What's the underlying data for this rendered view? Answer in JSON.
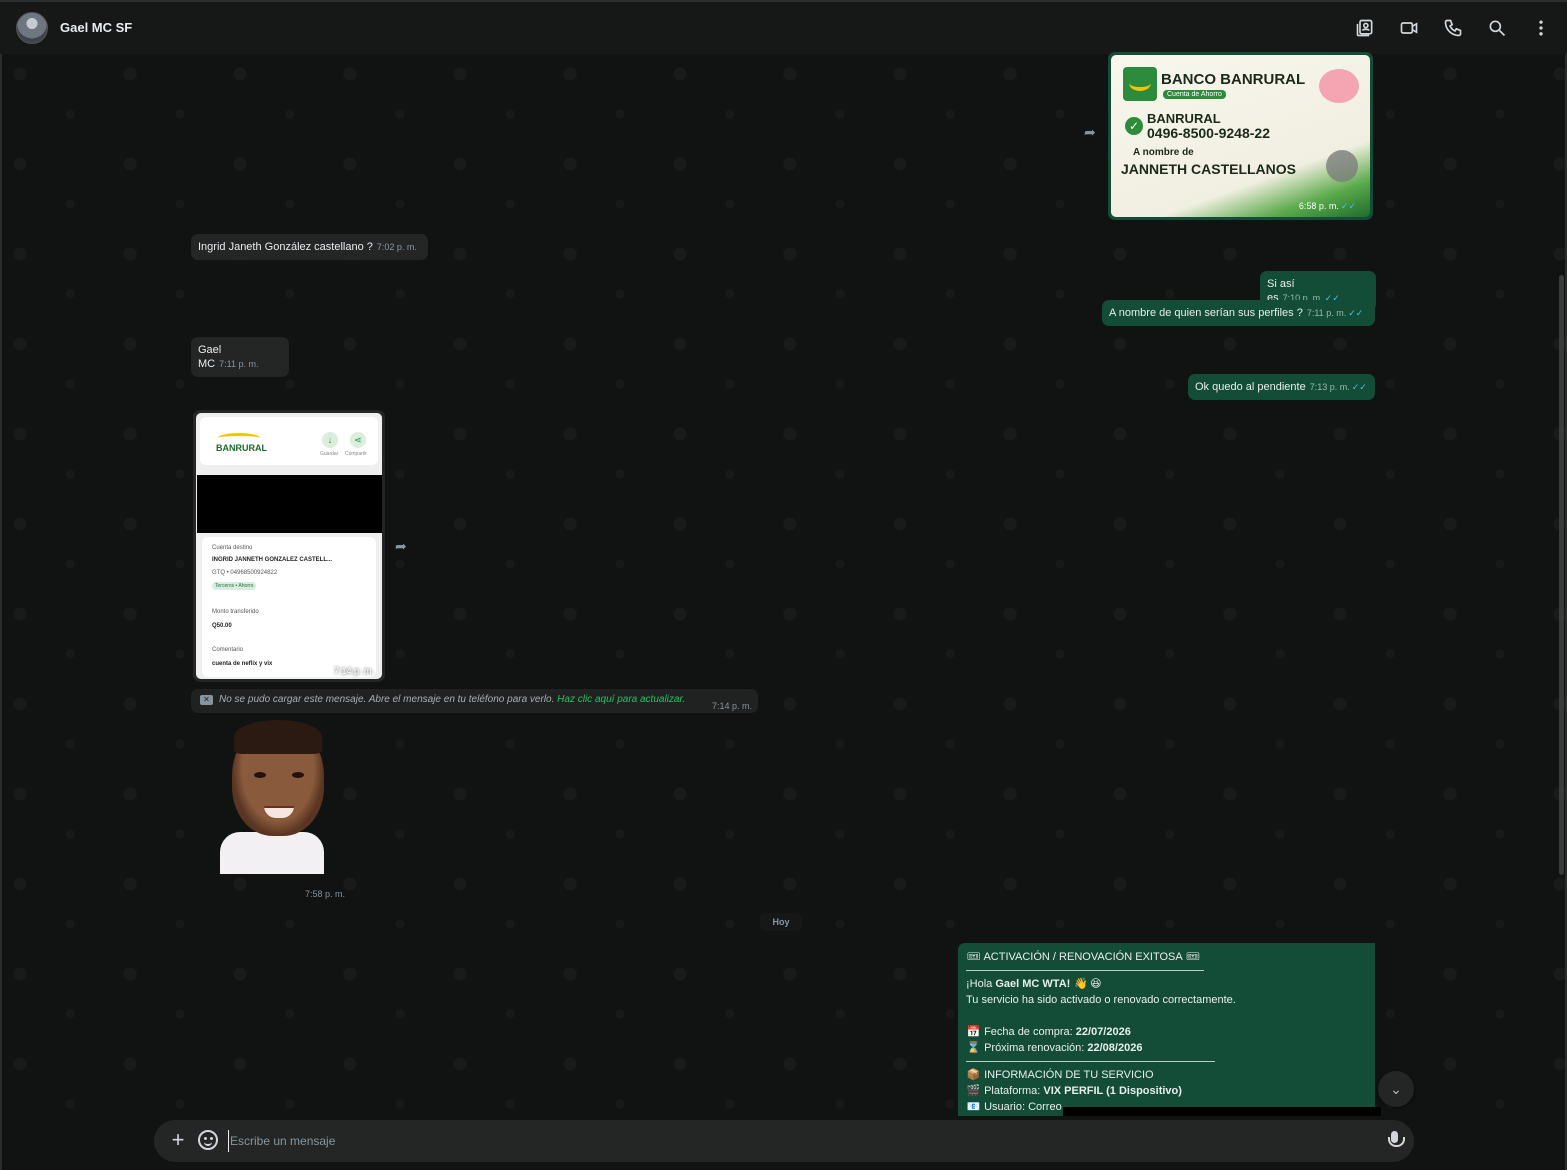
{
  "header": {
    "contact_name": "Gael MC SF",
    "icons": [
      "contact-card-icon",
      "video-call-icon",
      "phone-icon",
      "search-icon",
      "more-options-icon"
    ]
  },
  "messages": {
    "image_banrural": {
      "bank_title": "BANCO BANRURAL",
      "bank_subtitle": "Cuenta de Ahorro",
      "bank_name": "BANRURAL",
      "account_number": "0496-8500-9248-22",
      "owner_label": "A nombre de",
      "owner_name": "JANNETH CASTELLANOS",
      "time": "6:58 p. m."
    },
    "msg1": {
      "text": "Ingrid Janeth González castellano ?",
      "time": "7:02 p. m."
    },
    "msg2": {
      "text": "Si así es",
      "time": "7:10 p. m."
    },
    "msg3": {
      "text": "A nombre de quien serían sus perfiles ?",
      "time": "7:11 p. m."
    },
    "msg4": {
      "text": "Gael MC",
      "time": "7:11 p. m."
    },
    "msg5": {
      "text": "Ok quedo al pendiente",
      "time": "7:13 p. m."
    },
    "receipt": {
      "logo": "BANRURAL",
      "save_label": "Guardar",
      "share_label": "Compartir",
      "dest_label": "Cuenta destino",
      "dest_name": "INGRID JANNETH GONZALEZ CASTELL...",
      "dest_account": "GTQ • 04968500924822",
      "dest_tag": "Terceros • Ahorro",
      "amount_label": "Monto transferido",
      "amount": "Q50.00",
      "comment_label": "Comentario",
      "comment": "cuenta de neflix y vix",
      "time": "7:14 p. m."
    },
    "failed": {
      "text": "No se pudo cargar este mensaje. Abre el mensaje en tu teléfono para verlo.",
      "link": "Haz clic aquí para actualizar.",
      "time": "7:14 p. m."
    },
    "sticker_time": "7:58 p. m.",
    "day_separator": "Hoy",
    "activation": {
      "title": "ACTIVACIÓN / RENOVACIÓN EXITOSA",
      "greeting_prefix": "¡Hola ",
      "greeting_name": "Gael MC WTA!",
      "line2": "Tu servicio ha sido activado o renovado correctamente.",
      "purchase_label": "Fecha de compra: ",
      "purchase_date": "22/07/2026",
      "renewal_label": "Próxima renovación: ",
      "renewal_date": "22/08/2026",
      "info_title": "INFORMACIÓN DE TU SERVICIO",
      "platform_label": "Plataforma: ",
      "platform": "VIX PERFIL (1 Dispositivo)",
      "user_label": "Usuario: Correo"
    }
  },
  "composer": {
    "placeholder": "Escribe un mensaje"
  },
  "colors": {
    "incoming_bubble": "#242626",
    "outgoing_bubble": "#144d37",
    "link": "#21c063",
    "read_tick": "#53bdeb"
  }
}
